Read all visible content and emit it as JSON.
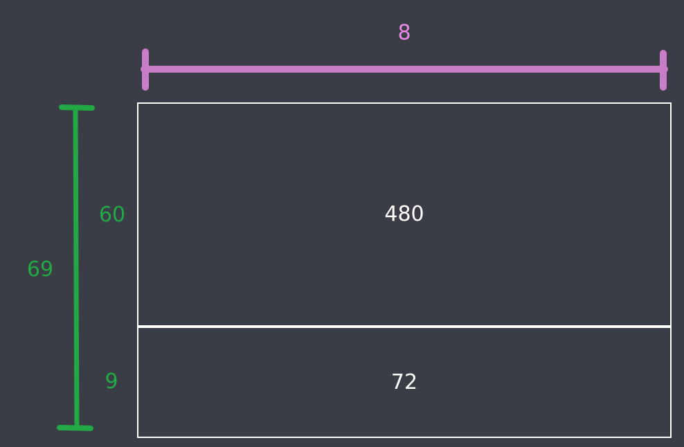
{
  "colors": {
    "background": "#3a3d46",
    "width_marker": "#c77dc8",
    "width_text": "#e98ae6",
    "height_marker": "#22a845",
    "height_text": "#22a845",
    "box_border": "#ffffff",
    "box_text": "#ffffff"
  },
  "width_dimension": {
    "value": "8"
  },
  "height_dimension": {
    "total": "69",
    "top_part": "60",
    "bottom_part": "9"
  },
  "boxes": {
    "top": {
      "value": "480"
    },
    "bottom": {
      "value": "72"
    }
  }
}
